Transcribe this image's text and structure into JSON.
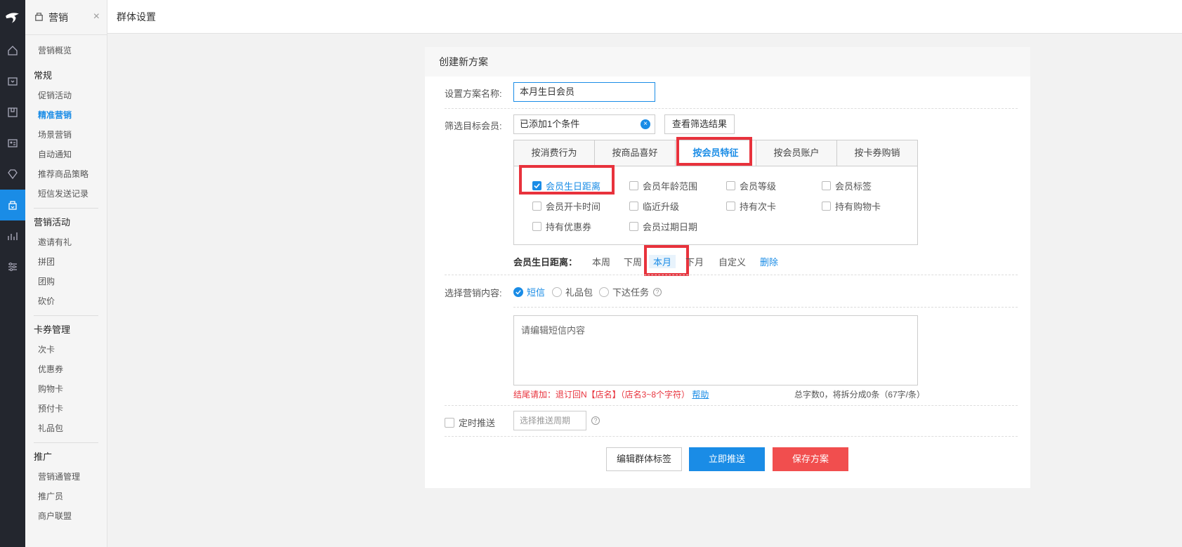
{
  "app": {
    "section_title": "营销",
    "page_title": "群体设置"
  },
  "sidebar": {
    "overview": "营销概览",
    "groups": [
      {
        "title": "常规",
        "items": [
          "促销活动",
          "精准营销",
          "场景营销",
          "自动通知",
          "推荐商品策略",
          "短信发送记录"
        ]
      },
      {
        "title": "营销活动",
        "items": [
          "邀请有礼",
          "拼团",
          "团购",
          "砍价"
        ]
      },
      {
        "title": "卡券管理",
        "items": [
          "次卡",
          "优惠券",
          "购物卡",
          "预付卡",
          "礼品包"
        ]
      },
      {
        "title": "推广",
        "items": [
          "营销通管理",
          "推广员",
          "商户联盟"
        ]
      }
    ],
    "active_item": "精准营销"
  },
  "rail": {
    "icons": [
      "logo-icon",
      "home-icon",
      "orders-icon",
      "goods-icon",
      "member-icon",
      "diamond-icon",
      "marketing-icon",
      "stats-icon",
      "settings-icon"
    ],
    "active": "marketing-icon",
    "accent": "#1a8ce6"
  },
  "form": {
    "card_title": "创建新方案",
    "name_label": "设置方案名称:",
    "name_value": "本月生日会员",
    "filter_label": "筛选目标会员:",
    "filter_value": "已添加1个条件",
    "view_results_button": "查看筛选结果",
    "tabs": [
      "按消费行为",
      "按商品喜好",
      "按会员特征",
      "按会员账户",
      "按卡券购销"
    ],
    "active_tab": "按会员特征",
    "options": [
      {
        "label": "会员生日距离",
        "checked": true
      },
      {
        "label": "会员年龄范围",
        "checked": false
      },
      {
        "label": "会员等级",
        "checked": false
      },
      {
        "label": "会员标签",
        "checked": false
      },
      {
        "label": "会员开卡时间",
        "checked": false
      },
      {
        "label": "临近升级",
        "checked": false
      },
      {
        "label": "持有次卡",
        "checked": false
      },
      {
        "label": "持有购物卡",
        "checked": false
      },
      {
        "label": "持有优惠券",
        "checked": false
      },
      {
        "label": "会员过期日期",
        "checked": false
      }
    ],
    "birthday_label": "会员生日距离：",
    "birthday_options": [
      "本周",
      "下周",
      "本月",
      "下月",
      "自定义"
    ],
    "birthday_selected": "本月",
    "delete_label": "删除",
    "content_label": "选择营销内容:",
    "content_options": [
      {
        "label": "短信",
        "checked": true
      },
      {
        "label": "礼品包",
        "checked": false
      },
      {
        "label": "下达任务",
        "checked": false
      }
    ],
    "sms_placeholder": "请编辑短信内容",
    "hint_text": "结尾请加：退订回N【店名】（店名3~8个字符）",
    "help_link": "帮助",
    "count_text": "总字数0，将拆分成0条（67字/条）",
    "schedule_label": "定时推送",
    "schedule_placeholder": "选择推送周期",
    "buttons": {
      "edit_tag": "编辑群体标签",
      "push_now": "立即推送",
      "save": "保存方案"
    }
  },
  "colors": {
    "accent": "#1a8ce6",
    "danger": "#f14e4e",
    "highlight_box": "#e8323c"
  }
}
